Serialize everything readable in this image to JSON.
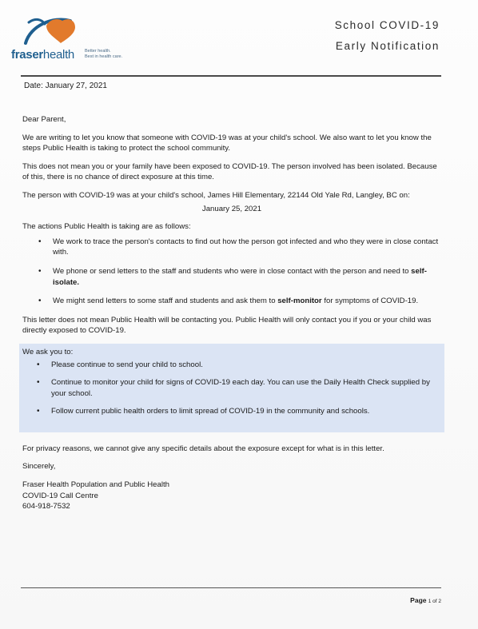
{
  "header": {
    "org_name_bold": "fraser",
    "org_name_rest": "health",
    "tagline_1": "Better health.",
    "tagline_2": "Best in health care.",
    "title": "School COVID-19",
    "subtitle": "Early Notification"
  },
  "date_line": "Date: January 27, 2021",
  "greeting": "Dear Parent,",
  "para1": "We are writing to let you know that someone with COVID-19 was at your child's school. We also want to let you know the steps Public Health is taking to protect the school community.",
  "para2": "This does not mean you or your family have been exposed to COVID-19. The person involved has been isolated. Because of this, there is no chance of direct exposure at this time.",
  "para3": "The person with COVID-19 was at your child's school, James Hill Elementary, 22144 Old Yale Rd, Langley, BC on:",
  "exposure_date": "January 25, 2021",
  "actions_intro": "The actions Public Health is taking are as follows:",
  "actions": [
    {
      "pre": "We work to trace the person's contacts to find out how the person got infected and who they were in close contact with.",
      "bold": "",
      "post": ""
    },
    {
      "pre": "We phone or send letters to the staff and students who were in close contact with the person and need to ",
      "bold": "self-isolate.",
      "post": ""
    },
    {
      "pre": "We might send letters to some staff and students and ask them to ",
      "bold": "self-monitor",
      "post": " for symptoms of COVID-19."
    }
  ],
  "para4": "This letter does not mean Public Health will be contacting you. Public Health will only contact you if you or your child was directly exposed to COVID-19.",
  "ask_title": "We ask you to:",
  "asks": [
    "Please continue to send your child to school.",
    "Continue to monitor your child for signs of COVID-19 each day.  You can use the Daily Health Check supplied by your school.",
    "Follow current public health orders to limit spread of COVID-19 in the community and schools."
  ],
  "privacy": "For privacy reasons, we cannot give any specific details about the exposure except for what is in this letter.",
  "closing": "Sincerely,",
  "signature": [
    "Fraser Health Population and Public Health",
    "COVID-19 Call Centre",
    "604-918-7532"
  ],
  "footer": {
    "page_label": "Page",
    "page_num": "1 of 2"
  },
  "colors": {
    "brand_blue": "#1f5f8f",
    "brand_orange": "#e27a2c",
    "highlight_box": "#dbe4f4"
  }
}
